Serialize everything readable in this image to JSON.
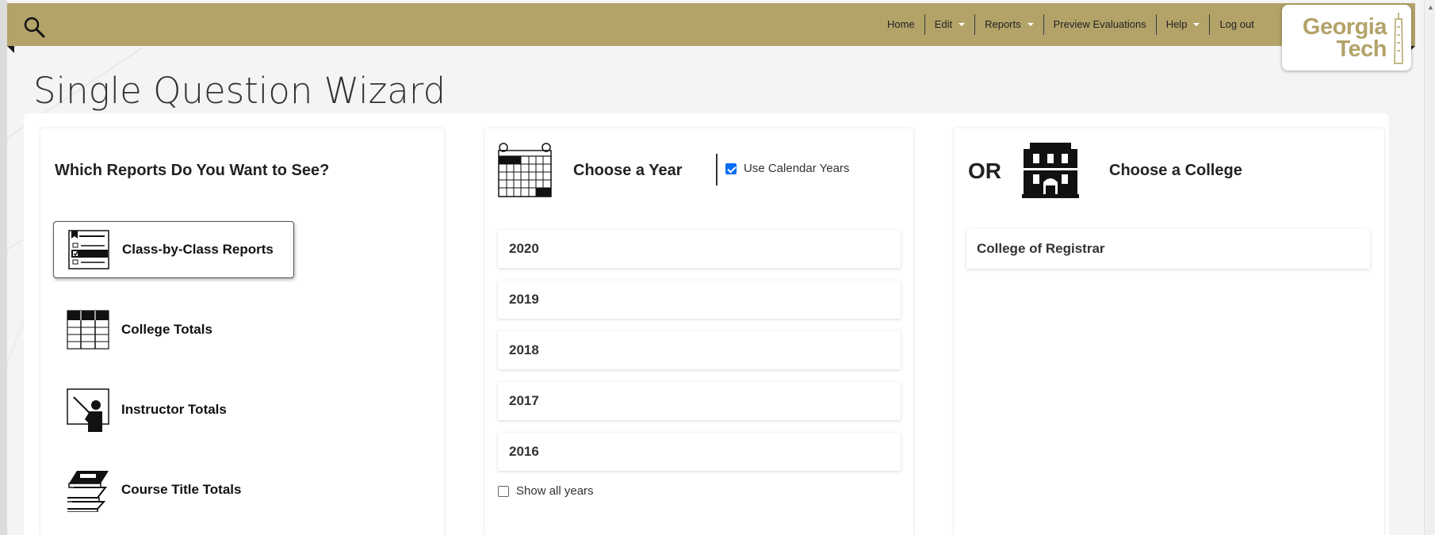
{
  "nav": {
    "items": [
      {
        "label": "Home",
        "dropdown": false
      },
      {
        "label": "Edit",
        "dropdown": true
      },
      {
        "label": "Reports",
        "dropdown": true
      },
      {
        "label": "Preview Evaluations",
        "dropdown": false
      },
      {
        "label": "Help",
        "dropdown": true
      },
      {
        "label": "Log out",
        "dropdown": false
      }
    ],
    "logo_line1": "Georgia",
    "logo_line2": "Tech"
  },
  "page": {
    "title": "Single Question Wizard"
  },
  "reports_panel": {
    "heading": "Which Reports Do You Want to See?",
    "items": [
      {
        "label": "Class-by-Class Reports",
        "icon": "checklist-icon",
        "selected": true
      },
      {
        "label": "College Totals",
        "icon": "table-icon",
        "selected": false
      },
      {
        "label": "Instructor Totals",
        "icon": "instructor-icon",
        "selected": false
      },
      {
        "label": "Course Title Totals",
        "icon": "books-icon",
        "selected": false
      }
    ]
  },
  "year_panel": {
    "heading": "Choose a Year",
    "calendar_years_label": "Use Calendar Years",
    "calendar_years_checked": true,
    "years": [
      "2020",
      "2019",
      "2018",
      "2017",
      "2016"
    ],
    "show_all_label": "Show all years",
    "show_all_checked": false
  },
  "college_panel": {
    "or_label": "OR",
    "heading": "Choose a College",
    "colleges": [
      "College of Registrar"
    ]
  },
  "colors": {
    "nav_bg": "#b3a369",
    "logo_gold": "#b3a369",
    "checkbox_blue": "#0b6ef5"
  }
}
